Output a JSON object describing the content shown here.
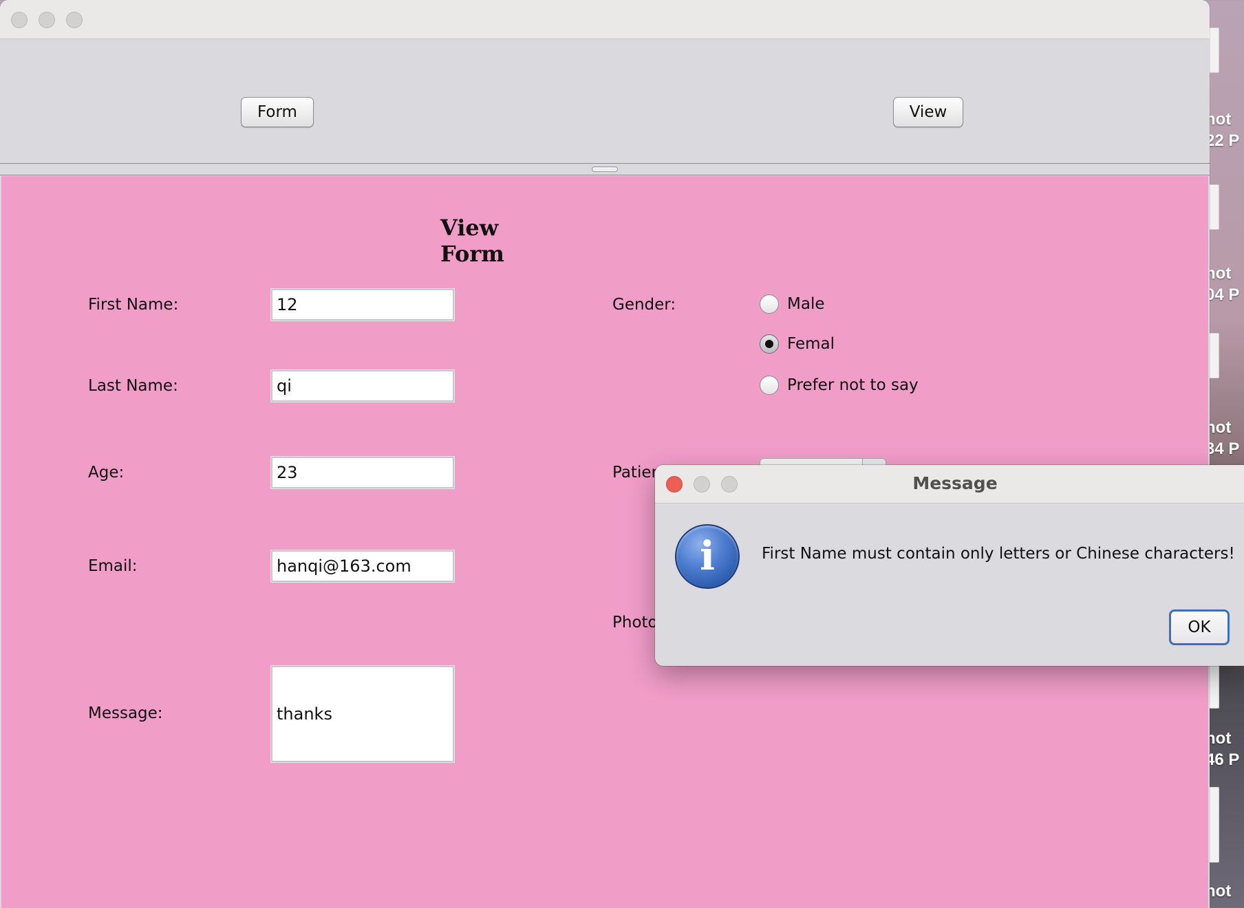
{
  "desktop": {
    "labels": [
      {
        "line1": "hot",
        "line2": "22 P"
      },
      {
        "line1": "hot",
        "line2": "04 P"
      },
      {
        "line1": "hot",
        "line2": "34 P"
      },
      {
        "line1": "hot",
        "line2": "46 P"
      },
      {
        "line1": "hot",
        "line2": ""
      }
    ]
  },
  "toolbar": {
    "form_label": "Form",
    "view_label": "View"
  },
  "form": {
    "title": "View Form",
    "first_name_label": "First Name:",
    "first_name_value": "12",
    "last_name_label": "Last Name:",
    "last_name_value": "qi",
    "age_label": "Age:",
    "age_value": "23",
    "email_label": "Email:",
    "email_value": "hanqi@163.com",
    "message_label": "Message:",
    "message_value": "thanks",
    "gender_label": "Gender:",
    "gender_options": [
      "Male",
      "Femal",
      "Prefer not to say"
    ],
    "gender_selected": "Femal",
    "patient_label_partial": "Patier",
    "photo_label_partial": "Photo"
  },
  "dialog": {
    "title": "Message",
    "message": "First Name must contain only letters or Chinese characters!",
    "ok_label": "OK",
    "icon": "info-icon"
  },
  "colors": {
    "form_background": "#f09dc8",
    "dialog_close": "#ec5f57",
    "info_icon": "#2e5cae"
  }
}
